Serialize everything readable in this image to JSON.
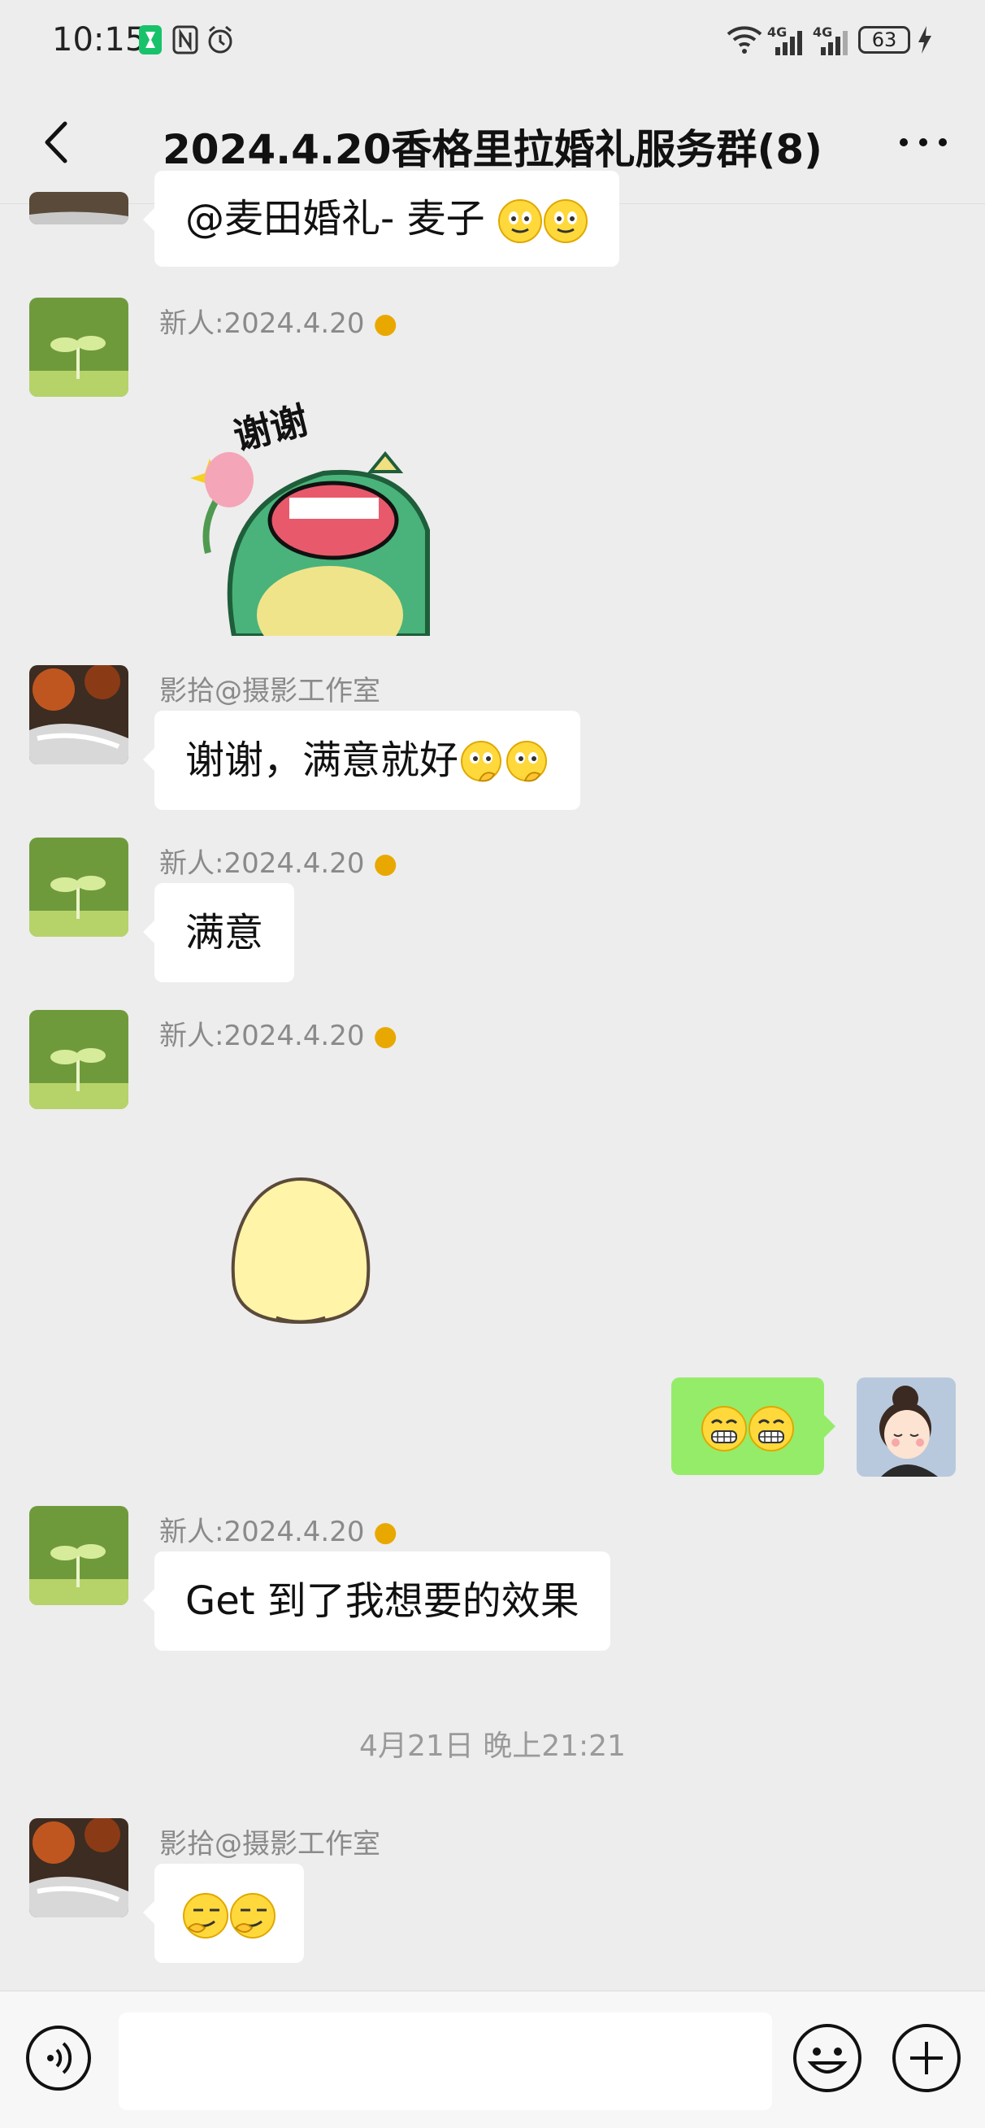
{
  "status": {
    "time": "10:15",
    "battery": "63",
    "network_1": "4G",
    "network_2": "4G"
  },
  "header": {
    "title": "2024.4.20香格里拉婚礼服务群(8)"
  },
  "messages": [
    {
      "type": "text",
      "text": "@麦田婚礼- 麦子"
    },
    {
      "type": "sticker",
      "sender": "新人:2024.4.20",
      "sticker_text": "谢谢"
    },
    {
      "type": "text",
      "sender": "影拾@摄影工作室",
      "text": "谢谢，满意就好"
    },
    {
      "type": "text",
      "sender": "新人:2024.4.20",
      "text": "满意"
    },
    {
      "type": "sticker",
      "sender": "新人:2024.4.20"
    },
    {
      "type": "text",
      "sender": "me"
    },
    {
      "type": "text",
      "sender": "新人:2024.4.20",
      "text": "Get 到了我想要的效果"
    },
    {
      "type": "timestamp",
      "text": "4月21日 晚上21:21"
    },
    {
      "type": "text",
      "sender": "影拾@摄影工作室"
    }
  ],
  "icons": {
    "back": "back-arrow-icon",
    "more": "more-icon",
    "voice": "voice-icon",
    "emoji": "emoji-icon",
    "plus": "plus-icon"
  },
  "colors": {
    "background": "#ededed",
    "bubble_self": "#95ec69",
    "bubble_other": "#ffffff"
  }
}
